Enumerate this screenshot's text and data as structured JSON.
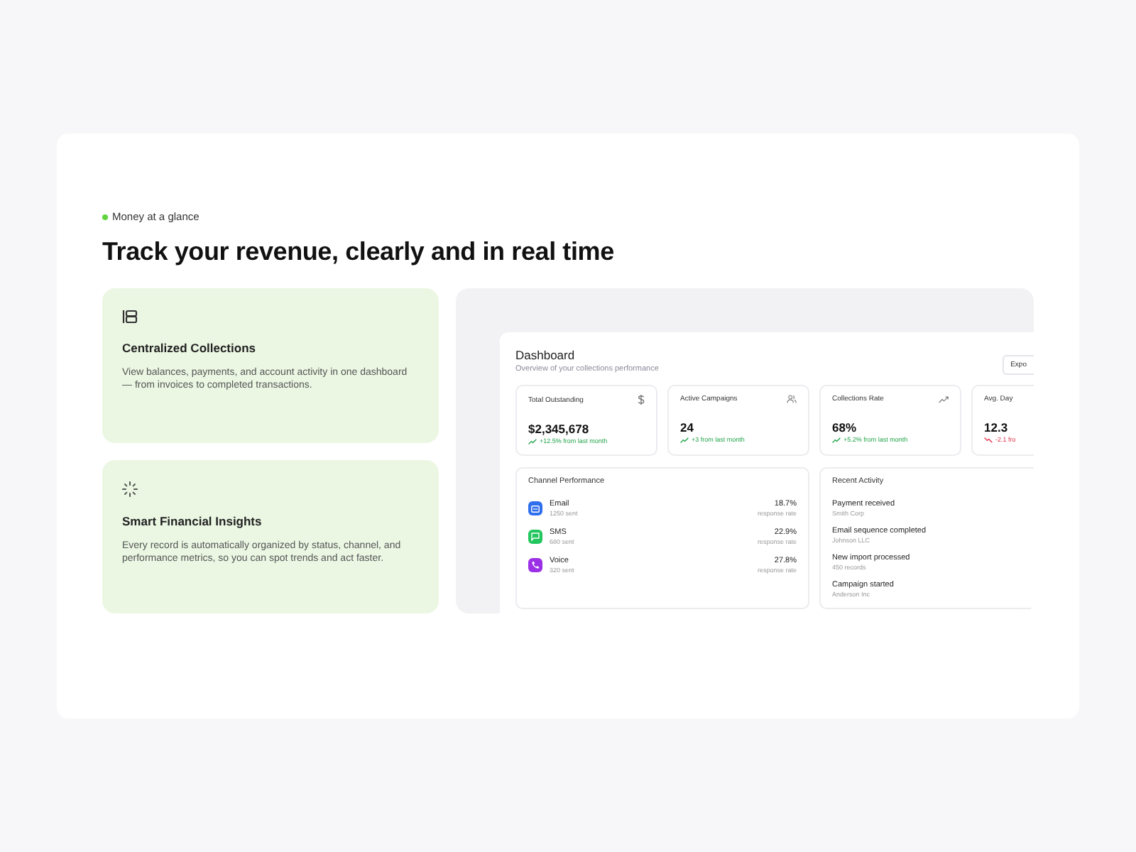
{
  "eyebrow": "Money at a glance",
  "headline": "Track your revenue, clearly and in real time",
  "features": [
    {
      "kind": "collections",
      "title": "Centralized Collections",
      "text": "View balances, payments, and account activity in one dashboard — from invoices to completed transactions."
    },
    {
      "kind": "insights",
      "title": "Smart Financial Insights",
      "text": "Every record is automatically organized by status, channel, and performance metrics, so you can spot trends and act faster."
    }
  ],
  "dashboard": {
    "title": "Dashboard",
    "subtitle": "Overview of your collections performance",
    "export_button": "Expo",
    "stats": [
      {
        "label": "Total Outstanding",
        "value": "$2,345,678",
        "kind": "up",
        "change": "+12.5% from last month"
      },
      {
        "label": "Active Campaigns",
        "value": "24",
        "kind": "up",
        "change": "+3 from last month"
      },
      {
        "label": "Collections Rate",
        "value": "68%",
        "kind": "up",
        "change": "+5.2% from last month"
      },
      {
        "label": "Avg. Day",
        "value": "12.3",
        "kind": "down",
        "change": "-2.1 fro"
      }
    ],
    "channel_performance": {
      "title": "Channel Performance",
      "channels": [
        {
          "kind": "email",
          "name": "Email",
          "sent": "1250 sent",
          "rate": "18.7%",
          "rate_label": "response rate",
          "color": "#2f6fed"
        },
        {
          "kind": "sms",
          "name": "SMS",
          "sent": "680 sent",
          "rate": "22.9%",
          "rate_label": "response rate",
          "color": "#22c55e"
        },
        {
          "kind": "voice",
          "name": "Voice",
          "sent": "320 sent",
          "rate": "27.8%",
          "rate_label": "response rate",
          "color": "#9b30e6"
        }
      ]
    },
    "recent_activity": {
      "title": "Recent Activity",
      "items": [
        {
          "title": "Payment received",
          "detail": "Smith Corp"
        },
        {
          "title": "Email sequence completed",
          "detail": "Johnson LLC"
        },
        {
          "title": "New import processed",
          "detail": "450 records"
        },
        {
          "title": "Campaign started",
          "detail": "Anderson Inc"
        }
      ]
    }
  }
}
